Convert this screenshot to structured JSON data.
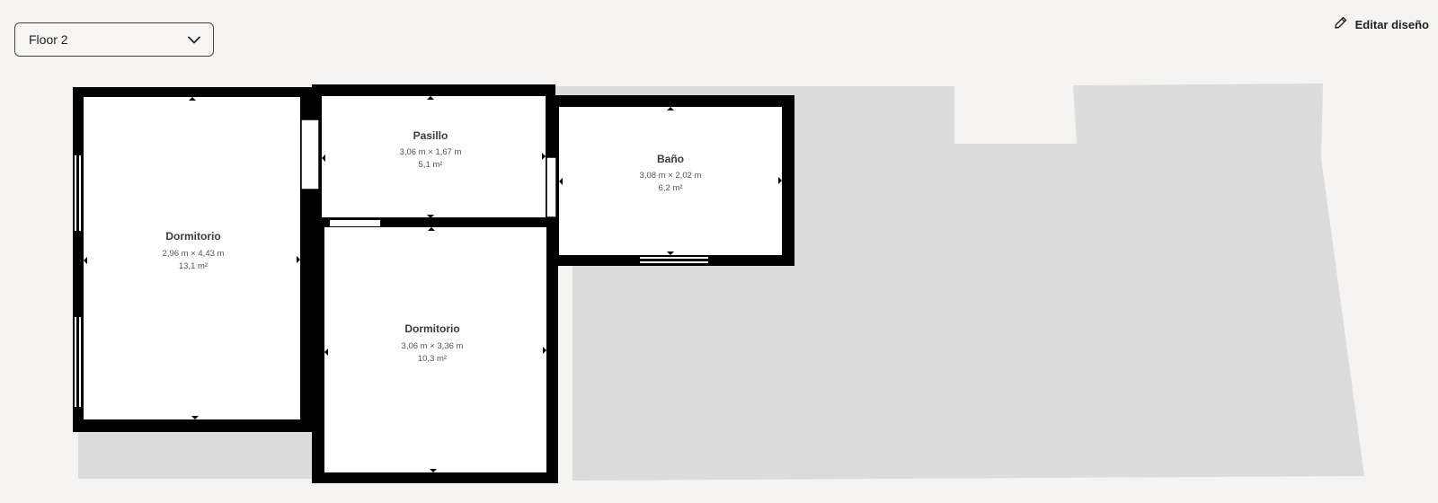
{
  "floor_selector": {
    "selected": "Floor 2"
  },
  "header": {
    "edit_label": "Editar diseño"
  },
  "rooms": [
    {
      "id": "dormitorio-1",
      "name": "Dormitorio",
      "dimensions": "2,96 m × 4,43 m",
      "area": "13,1 m²"
    },
    {
      "id": "pasillo",
      "name": "Pasillo",
      "dimensions": "3,06 m × 1,67 m",
      "area": "5,1 m²"
    },
    {
      "id": "bano",
      "name": "Baño",
      "dimensions": "3,08 m × 2,02 m",
      "area": "6,2 m²"
    },
    {
      "id": "dormitorio-2",
      "name": "Dormitorio",
      "dimensions": "3,06 m × 3,36 m",
      "area": "10,3 m²"
    }
  ],
  "colors": {
    "wall": "#000000",
    "room_fill": "#ffffff",
    "background_area": "#dcdcdc",
    "page_bg": "#f5f4f2"
  }
}
